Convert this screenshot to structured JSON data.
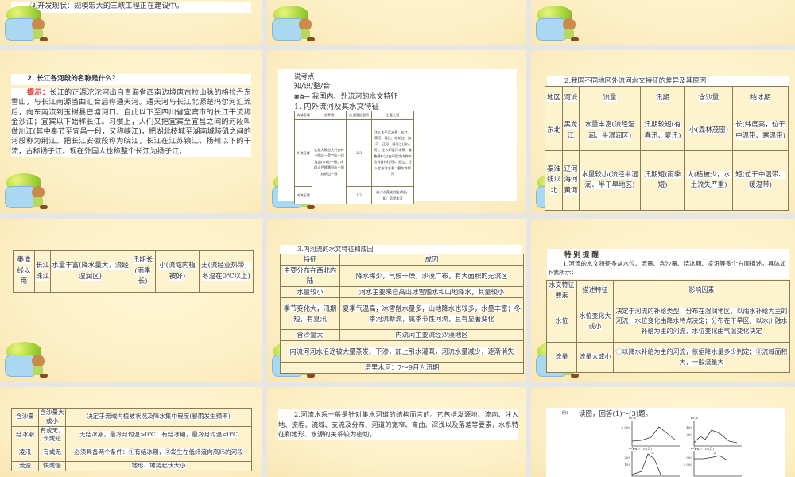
{
  "slides": {
    "s0a": {
      "text": "③开发现状：规模宏大的三峡工程正在建设中。"
    },
    "s1a": {
      "question": "2. 长江各河段的名称是什么？",
      "hint_label": "提示：",
      "answer": "长江的正源沱沱河出自青海省西南边境唐古拉山脉的格拉丹东雪山，与长江南源当曲汇合后称通天河。通天河与长江北源楚玛尔河汇流后，向东南流到玉树县巴塘河口。自此以下至四川省宜宾市的长江干流称金沙江；宜宾以下始称长江。习惯上，人们又把宜宾至宜昌之间的河段叫做川江(其中奉节至宜昌一段，又称峡江)，把湖北枝城至湖南城陵矶之间的河段称为荆江。把长江安徽段称为皖江，长江在江苏镇江、扬州以下的干流，古称扬子江。现在外国人也称整个长江为扬子江。"
    },
    "s1b": {
      "line1": "说考点",
      "line2": "知/识/整/合",
      "point_label": "要点一",
      "point_title": "我国内、外流河的水文特征",
      "subtitle": "1. 内外流河及其水文特征",
      "table": [
        [
          "流域区域",
          "分界线",
          "占全国总面积",
          "主要大河"
        ],
        [
          "外流区域",
          {
            "text": "北段大致沿大兴安岭—阴山—贺兰山—祁连山(东端)一线；南段沿巴颜喀拉山—冈底斯山一线",
            "rowspan": 2
          },
          "2/3",
          "注入太平洋水系：长江、黄河、珠江、松花江、海河、辽河、澜沧江(湄公河)；注入印度洋水系：雅鲁藏布江(在印度境内称布拉马普特拉河)、怒江；注入北冰洋水系：额尔齐斯河"
        ],
        [
          "内流区域",
          "1/3",
          "流入沙漠或内陆湖泊，如：塔里木河"
        ]
      ]
    },
    "s1c": {
      "title": "2.我国不同地区外流河水文特征的差异及其原因",
      "table": [
        [
          "地区",
          "河流",
          "流量",
          "汛期",
          "含沙量",
          "结冰期"
        ],
        [
          "东北",
          "黑龙江",
          "水量丰富(流经湿润、半湿润区)",
          "汛期较短(有春汛、夏汛)",
          "小(森林茂密)",
          "长(纬度高，位于中温带、寒温带)"
        ],
        [
          "秦淮线以北",
          "辽河海河黄河",
          "水量较小(流经半湿润、半干旱地区)",
          "汛期短(雨季短)",
          "大(植被少，水土流失严重)",
          "短(位于中温带、暖温带)"
        ]
      ]
    },
    "s2a": {
      "table": [
        [
          "秦淮线以南",
          "长江珠江",
          "水量丰富(降水量大，流经湿润区)",
          "汛期长(雨季长)",
          "小(流域内植被好)",
          "无(流经亚热带，冬温在0℃以上)"
        ]
      ]
    },
    "s2b": {
      "title": "3.内河流的水文特征和成因",
      "table": [
        [
          "特征",
          "成因"
        ],
        [
          "主要分布在西北内陆",
          "降水稀少，气候干燥，沙漠广布，有大面积的无流区"
        ],
        [
          "水量较小",
          "河水主要来自高山冰雪融水和山地降水，其量较小"
        ],
        [
          "季节变化大，汛期短，有夏汛",
          "夏季气温高，冰雪融水量多，山地降水也较多，水量丰富；冬季河流断流，属季节性河流，且有显著变化"
        ],
        [
          "含沙量大",
          "内流河主要流经沙漠地区"
        ],
        [
          {
            "text": "内流河河水沿途被大量蒸发、下渗，加上引水灌溉，河流水量减少，逐渐消失",
            "colspan": 2
          }
        ],
        [
          {
            "text": "塔里木河：7～9月为汛期",
            "colspan": 2
          }
        ]
      ]
    },
    "s2c": {
      "title": "特 别 提 醒",
      "intro": "1.河流的水文特征多从水位、流量、含沙量、结冰期、凌汛等多个方面描述，具体如下表所示：",
      "table": [
        [
          "水文特征要素",
          "描述特征",
          "影响因素"
        ],
        [
          "水位",
          "水位变化大或小",
          "决定于河流的补给类型：分布在湿润地区、以雨水补给为主的河流，水位变化由降水特点决定；分布在干旱区、以冰川融水补给为主的河流，水位变化由气温变化决定"
        ],
        [
          "流量",
          "流量大或小",
          "①以降水补给为主的河流，依据降水量多少判定；②流域面积大，一般流量大"
        ]
      ]
    },
    "s3a": {
      "table": [
        [
          "含沙量",
          "含沙量大或小",
          "决定于流域内植被状况及降水集中程度(暴雨发生频率)"
        ],
        [
          "结冰期",
          "有或无，长或短",
          "无结冰期，最冷月均温>0℃；有结冰期，最冷月均温<0℃"
        ],
        [
          "凌汛",
          "有或无",
          "必须具备两个条件：①有结冰期，②发生在低纬流向高纬的河段"
        ],
        [
          "流速",
          "快或慢",
          "地形、地势起伏大小"
        ]
      ]
    },
    "s3b": {
      "text": "2.河流水系一般是针对集水河道的结构而言的。它包括发源地、流向、注入地、流程、流域、支流及分布、河道的宽窄、弯曲、深浅以及落差等要素，水系特征和地形、水源的关系较为密切。"
    },
    "s3c": {
      "label": "例1",
      "question": "读图，回答(1)～(3)题。",
      "charts": [
        {
          "unit": "m³/s",
          "yticks": [
            "2 000"
          ],
          "xticks": "1  4  7  10 (月)",
          "caption": "①"
        },
        {
          "unit": "m³/s",
          "yticks": [
            "400",
            "200"
          ],
          "xticks": "1  4  7  10 (月)",
          "caption": "②"
        },
        {
          "unit": "m³/s",
          "yticks": [
            "200",
            "150"
          ]
        },
        {
          "unit": "m³/s",
          "yticks": [
            "1 000",
            "2 000"
          ]
        }
      ]
    }
  }
}
